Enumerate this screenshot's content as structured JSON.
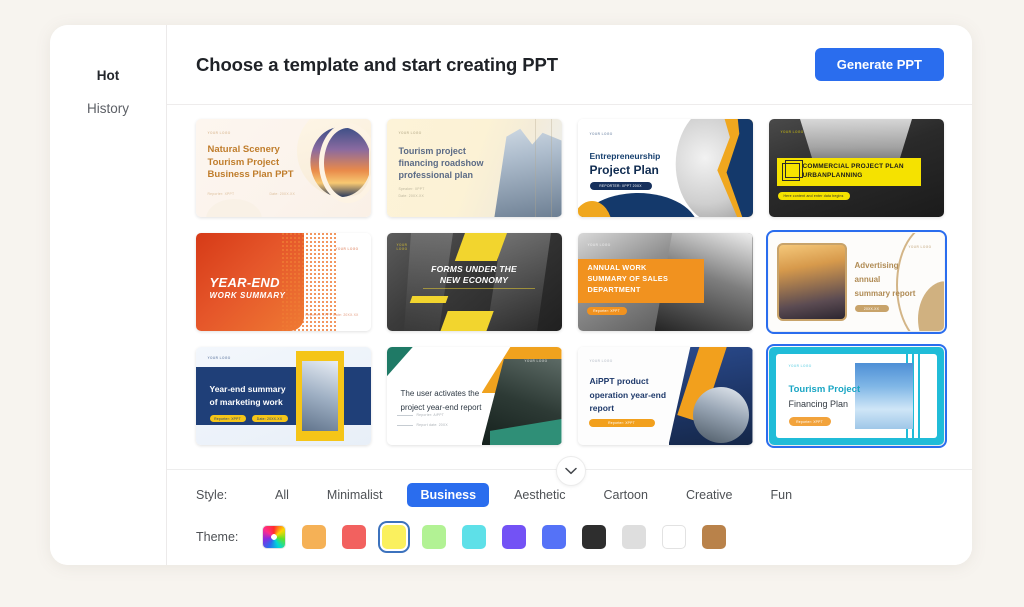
{
  "sidebar": {
    "items": [
      {
        "label": "Hot",
        "active": true
      },
      {
        "label": "History",
        "active": false
      }
    ]
  },
  "header": {
    "title": "Choose a template and start creating PPT",
    "generate_label": "Generate PPT",
    "accent_color": "#2a6dee"
  },
  "templates": [
    {
      "id": "natural-scenery-tourism",
      "title": "Natural Scenery\nTourism Project\nBusiness Plan PPT",
      "logo": "YOUR LOGO",
      "meta_left": "Reporter: XPPT",
      "meta_right": "Date: 20XX.XX",
      "selected": false
    },
    {
      "id": "tourism-financing-roadshow",
      "title": "Tourism project\nfinancing roadshow\nprofessional plan",
      "logo": "YOUR LOGO",
      "meta_left": "Speaker: XPPT",
      "meta_right": "Date: 20XX.XX",
      "selected": false
    },
    {
      "id": "entrepreneurship-project-plan",
      "title_small": "Entrepreneurship",
      "title_large": "Project Plan",
      "logo": "YOUR LOGO",
      "button_text": "REPORTER: XPPT 20XX",
      "selected": false
    },
    {
      "id": "commercial-project-plan-urbanplanning",
      "title": "COMMERCIAL PROJECT  PLAN\nURBANPLANNING",
      "logo": "YOUR LOGO",
      "button_text": "Here content and enter data begins",
      "selected": false
    },
    {
      "id": "year-end-work-summary",
      "title_large": "YEAR-END",
      "title_small": "WORK SUMMARY",
      "logo": "YOUR LOGO",
      "meta_left": "Reporter: XPPT    Date: 20XX.XX",
      "selected": false
    },
    {
      "id": "forms-under-the-new-economy",
      "title": "FORMS UNDER THE\nNEW ECONOMY",
      "logo": "YOUR\nLOGO",
      "selected": false
    },
    {
      "id": "annual-work-summary-sales",
      "title": "ANNUAL WORK\nSUMMARY OF SALES\nDEPARTMENT",
      "logo": "YOUR LOGO",
      "button_text": "Reporter: XPPT",
      "selected": false
    },
    {
      "id": "advertising-annual-summary-report",
      "title": "Advertising\nannual\nsummary report",
      "logo": "YOUR LOGO",
      "button_text": "20XX.XX",
      "selected": true
    },
    {
      "id": "year-end-summary-marketing",
      "title": "Year-end summary\nof marketing work",
      "logo": "YOUR LOGO",
      "button_text": "Reporter: XPPT",
      "button_text2": "Date: 20XX.XX",
      "selected": false
    },
    {
      "id": "user-activates-project-year-end-report",
      "title": "The user activates the\nproject year-end report",
      "logo": "YOUR LOGO",
      "bullet1": "Reporter: AiPPT",
      "bullet2": "Report date: 20XX",
      "selected": false
    },
    {
      "id": "aippt-product-operation-year-end",
      "title": "AiPPT product\noperation year-end\nreport",
      "logo": "YOUR LOGO",
      "button_text": "Reporter: XPPT",
      "selected": false
    },
    {
      "id": "tourism-project-financing-plan",
      "title_large": "Tourism Project",
      "title_small": "Financing Plan",
      "logo": "YOUR LOGO",
      "button_text": "Reporter: XPPT",
      "selected": true
    }
  ],
  "filters": {
    "style": {
      "label": "Style:",
      "options": [
        {
          "label": "All",
          "active": false
        },
        {
          "label": "Minimalist",
          "active": false
        },
        {
          "label": "Business",
          "active": true
        },
        {
          "label": "Aesthetic",
          "active": false
        },
        {
          "label": "Cartoon",
          "active": false
        },
        {
          "label": "Creative",
          "active": false
        },
        {
          "label": "Fun",
          "active": false
        }
      ]
    },
    "theme": {
      "label": "Theme:",
      "options": [
        {
          "name": "color-wheel",
          "color": "rainbow",
          "selected": false
        },
        {
          "name": "orange",
          "color": "#f5b156",
          "selected": false
        },
        {
          "name": "red",
          "color": "#f2615f",
          "selected": false
        },
        {
          "name": "yellow",
          "color": "#faf05e",
          "selected": true
        },
        {
          "name": "light-green",
          "color": "#b2f294",
          "selected": false
        },
        {
          "name": "cyan",
          "color": "#5ee0e8",
          "selected": false
        },
        {
          "name": "purple",
          "color": "#7352f5",
          "selected": false
        },
        {
          "name": "blue",
          "color": "#5572f7",
          "selected": false
        },
        {
          "name": "dark",
          "color": "#2e2e2e",
          "selected": false
        },
        {
          "name": "light-gray",
          "color": "#dedede",
          "selected": false
        },
        {
          "name": "white",
          "color": "#ffffff",
          "selected": false
        },
        {
          "name": "brown",
          "color": "#b9824a",
          "selected": false
        }
      ]
    },
    "collapse_icon": "chevron-down-icon"
  }
}
